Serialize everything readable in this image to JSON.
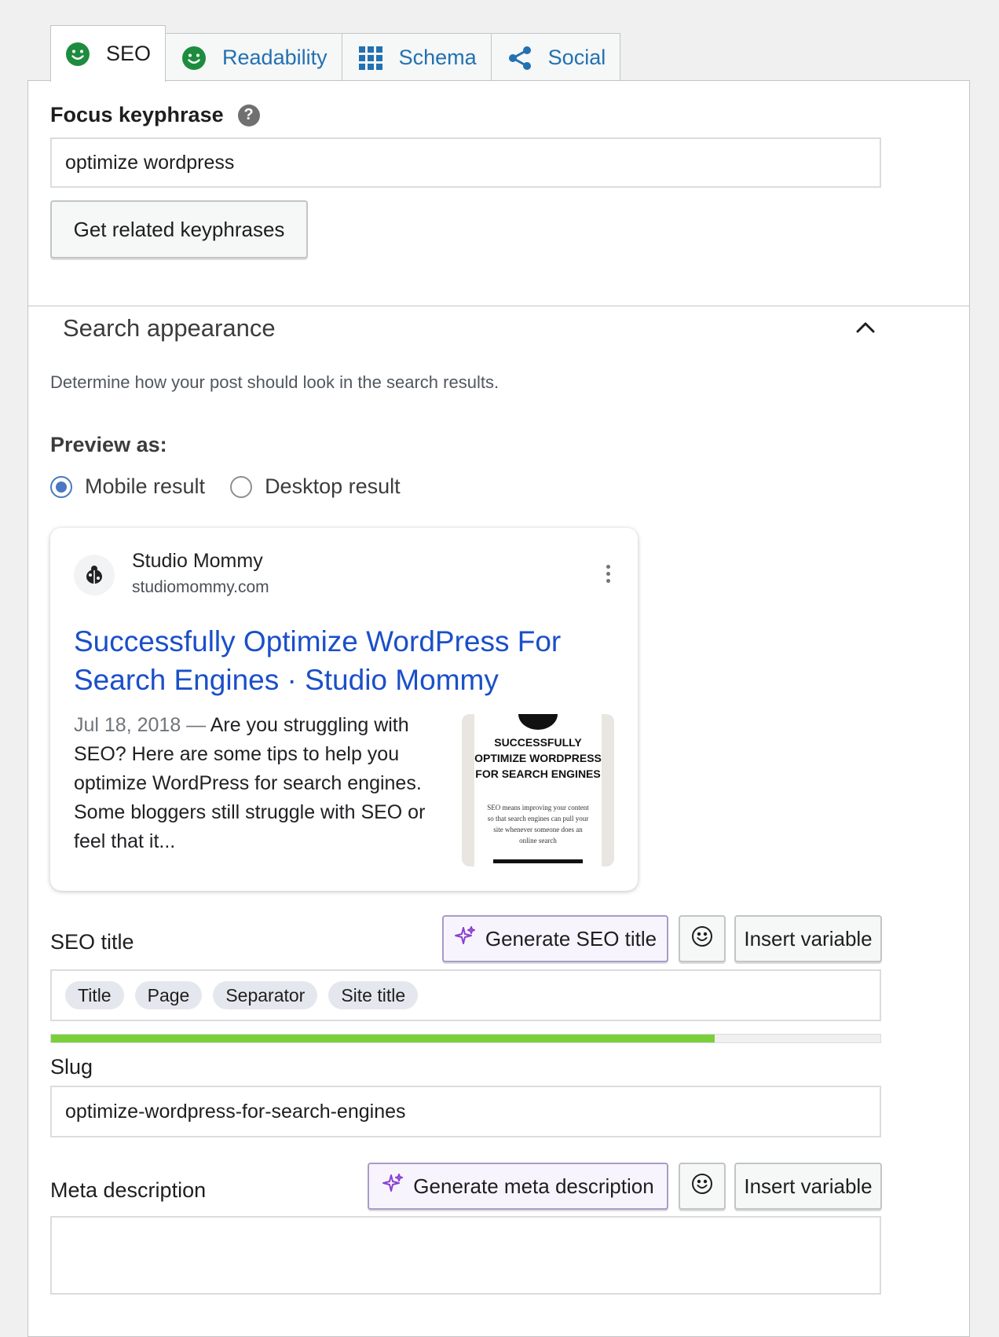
{
  "tabs": [
    {
      "label": "SEO",
      "icon": "smiley-good-icon",
      "active": true
    },
    {
      "label": "Readability",
      "icon": "smiley-good-icon",
      "active": false
    },
    {
      "label": "Schema",
      "icon": "grid-icon",
      "active": false
    },
    {
      "label": "Social",
      "icon": "share-icon",
      "active": false
    }
  ],
  "colors": {
    "good": "#1e8c3e",
    "link": "#2271b1",
    "ai": "#8a3fd1",
    "progress": "#7ad03a"
  },
  "focus": {
    "label": "Focus keyphrase",
    "value": "optimize wordpress",
    "related_button": "Get related keyphrases"
  },
  "search_appearance": {
    "title": "Search appearance",
    "description": "Determine how your post should look in the search results.",
    "preview_label": "Preview as:",
    "options": [
      "Mobile result",
      "Desktop result"
    ],
    "selected": "Mobile result"
  },
  "preview": {
    "site_name": "Studio Mommy",
    "site_url": "studiomommy.com",
    "title": "Successfully Optimize WordPress For Search Engines · Studio Mommy",
    "date": "Jul 18, 2018",
    "dash": "—",
    "snippet": "Are you struggling with SEO? Here are some tips to help you optimize WordPress for search engines. Some bloggers still struggle with SEO or feel that it...",
    "thumb_heading": "SUCCESSFULLY OPTIMIZE WORDPRESS FOR SEARCH ENGINES",
    "thumb_text": "SEO means improving your content so that search engines can pull your site whenever someone does an online search"
  },
  "seo_title": {
    "label": "SEO title",
    "generate_button": "Generate SEO title",
    "insert_button": "Insert variable",
    "chips": [
      "Title",
      "Page",
      "Separator",
      "Site title"
    ],
    "progress": 0.8
  },
  "slug": {
    "label": "Slug",
    "value": "optimize-wordpress-for-search-engines"
  },
  "meta": {
    "label": "Meta description",
    "generate_button": "Generate meta description",
    "insert_button": "Insert variable"
  }
}
